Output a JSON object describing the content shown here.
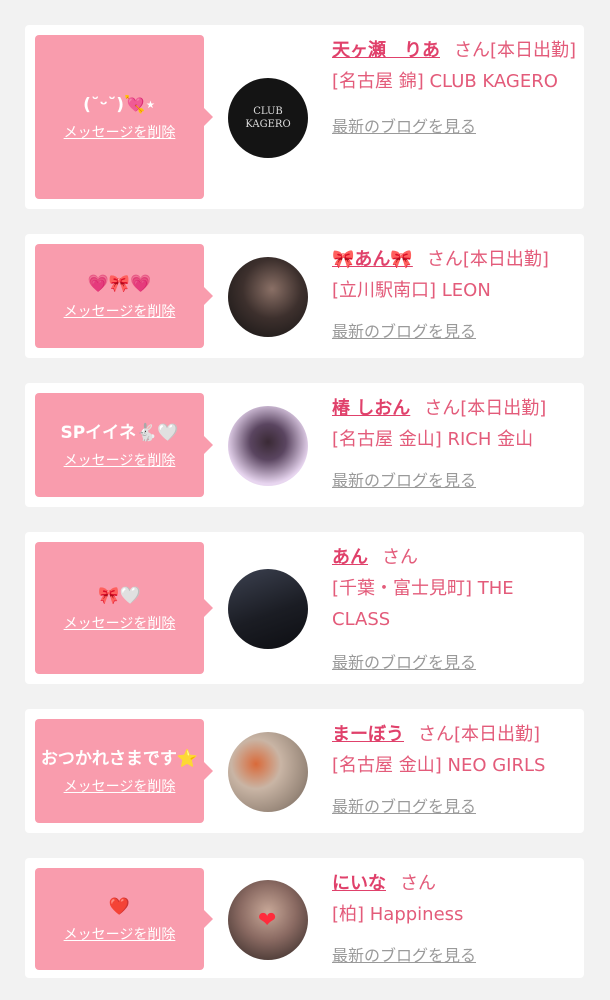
{
  "cards": [
    {
      "message": "(˘ᵕ˘)💘⋆",
      "delete_label": "メッセージを削除",
      "name": "天ヶ瀬　りあ",
      "honorific": "さん",
      "work_status": "[本日出勤]",
      "location": "[名古屋 錦] CLUB KAGERO",
      "blog_label": "最新のブログを見る",
      "avatar_text": "CLUB KAGERO",
      "avatar_color": "#1a1a1a"
    },
    {
      "message": "💗🎀💗",
      "delete_label": "メッセージを削除",
      "name": "🎀あん🎀",
      "honorific": "さん",
      "work_status": "[本日出勤]",
      "location": "[立川駅南口] LEON",
      "blog_label": "最新のブログを見る",
      "avatar_color": "#3a2f2d"
    },
    {
      "message": "SPイイネ🐇🤍",
      "delete_label": "メッセージを削除",
      "name": "椿 しおん",
      "honorific": "さん",
      "work_status": "[本日出勤]",
      "location": "[名古屋 金山] RICH 金山",
      "blog_label": "最新のブログを見る",
      "avatar_color": "#d8c6e8"
    },
    {
      "message": "🎀🤍",
      "delete_label": "メッセージを削除",
      "name": "あん",
      "honorific": "さん",
      "work_status": "",
      "location": "[千葉・富士見町] THE CLASS",
      "blog_label": "最新のブログを見る",
      "avatar_color": "#20222a"
    },
    {
      "message": "おつかれさまです⭐️",
      "delete_label": "メッセージを削除",
      "name": "まーぼう",
      "honorific": "さん",
      "work_status": "[本日出勤]",
      "location": "[名古屋 金山] NEO GIRLS",
      "blog_label": "最新のブログを見る",
      "avatar_color": "#b9a99a"
    },
    {
      "message": "❤️",
      "delete_label": "メッセージを削除",
      "name": "にいな",
      "honorific": "さん",
      "work_status": "",
      "location": "[柏] Happiness",
      "blog_label": "最新のブログを見る",
      "avatar_color": "#6e5e58"
    }
  ]
}
